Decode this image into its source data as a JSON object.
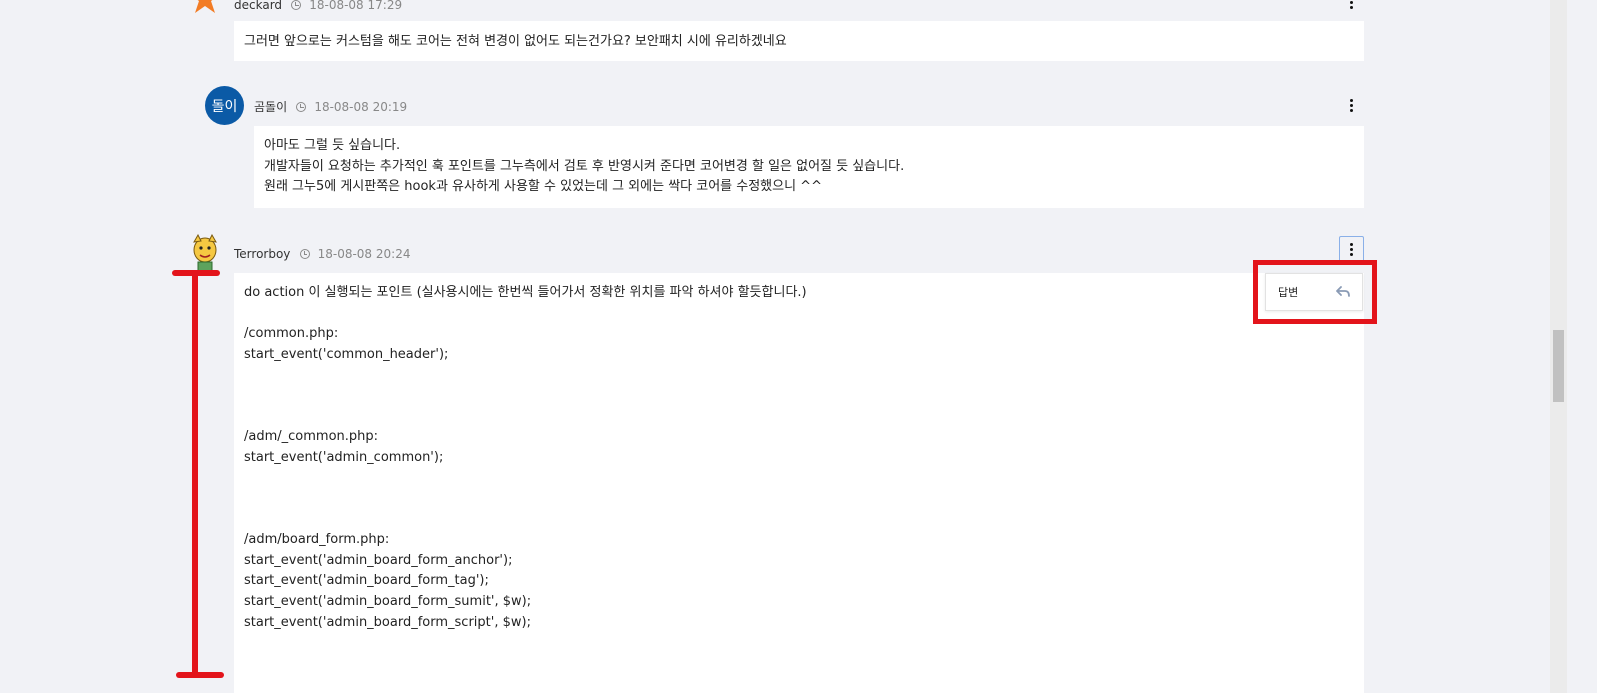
{
  "comments": [
    {
      "author": "deckard",
      "date": "18-08-08 17:29",
      "lines": [
        "그러면 앞으로는 커스텀을 해도 코어는 전혀 변경이 없어도 되는건가요? 보안패치 시에 유리하겠네요"
      ]
    },
    {
      "author": "곰돌이",
      "avatar_text": "돌이",
      "date": "18-08-08 20:19",
      "lines": [
        "아마도 그럴 듯 싶습니다.",
        "개발자들이 요청하는 추가적인 훅 포인트를 그누측에서 검토 후 반영시켜 준다면 코어변경 할 일은 없어질 듯 싶습니다.",
        "원래 그누5에 게시판쪽은 hook과 유사하게 사용할 수 있었는데 그 외에는 싹다 코어를 수정했으니 ^^"
      ]
    },
    {
      "author": "Terrorboy",
      "date": "18-08-08 20:24",
      "lines": [
        "do action 이 실행되는 포인트 (실사용시에는 한번씩 들어가서 정확한 위치를 파악 하셔야 할듯합니다.)",
        "",
        "/common.php:",
        "start_event('common_header');",
        "",
        "",
        "",
        "/adm/_common.php:",
        "start_event('admin_common');",
        "",
        "",
        "",
        "/adm/board_form.php:",
        "start_event('admin_board_form_anchor');",
        "start_event('admin_board_form_tag');",
        "start_event('admin_board_form_sumit', $w);",
        "start_event('admin_board_form_script', $w);"
      ]
    }
  ],
  "reply_menu": {
    "label": "답변"
  },
  "colors": {
    "highlight": "#e3141b",
    "avatar_bg": "#0b5aa6"
  }
}
